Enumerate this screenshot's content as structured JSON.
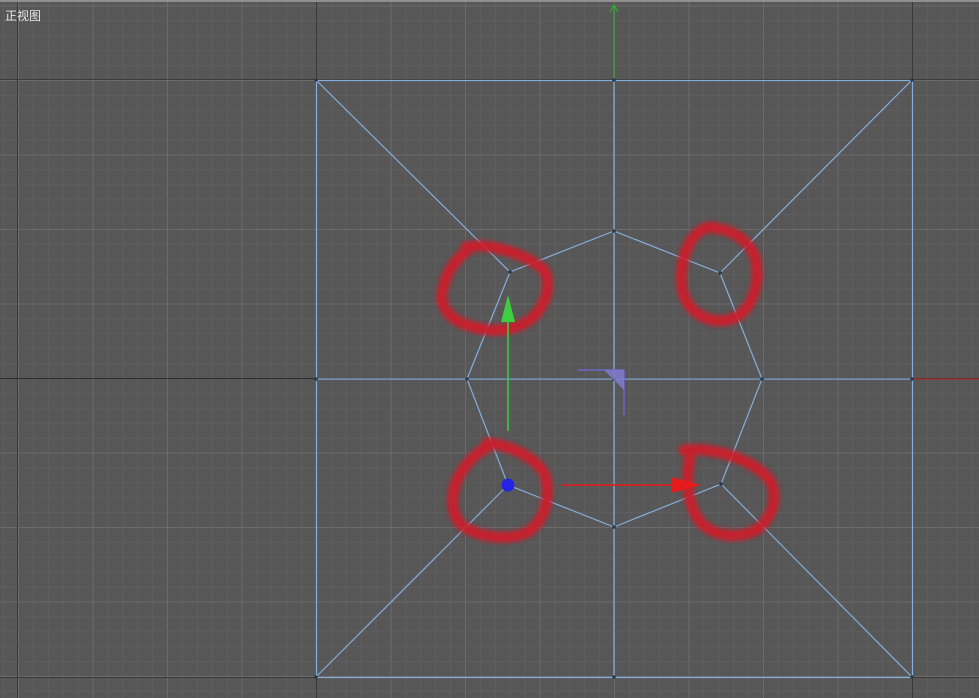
{
  "viewport": {
    "label": "正视图",
    "view": "front",
    "colors": {
      "background": "#575757",
      "grid_minor": "#5f5f5f",
      "grid_major": "#6b6b6b",
      "axis_lines": "#2e2e2e",
      "mesh_wire": "#86aedc",
      "y_axis": "#2db52d",
      "x_axis": "#e03a3a",
      "gizmo_y": "#3ecf3e",
      "gizmo_x": "#e61c1c",
      "gizmo_center": "#2323e6",
      "plane_handle": "#6b67c7",
      "annotation": "#cf1f2a"
    },
    "annotations": [
      {
        "name": "circle-upper-left"
      },
      {
        "name": "circle-upper-right"
      },
      {
        "name": "circle-lower-left"
      },
      {
        "name": "circle-lower-right"
      }
    ]
  }
}
